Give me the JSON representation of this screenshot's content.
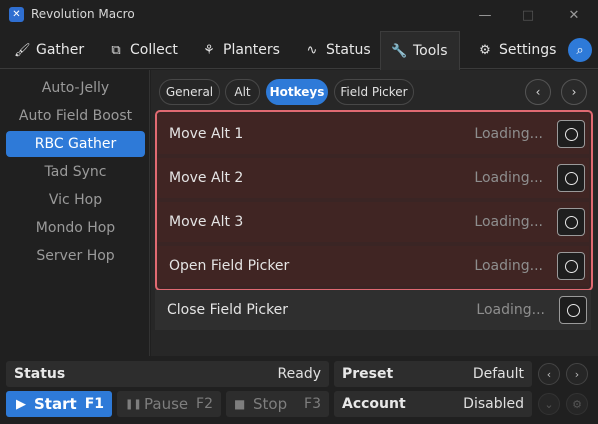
{
  "window": {
    "title": "Revolution Macro",
    "minimize": "—",
    "maximize": "□",
    "close": "✕"
  },
  "tabs": [
    {
      "label": "Gather",
      "icon": "brush-icon",
      "glyph": "🖌"
    },
    {
      "label": "Collect",
      "icon": "collect-icon",
      "glyph": "⧉"
    },
    {
      "label": "Planters",
      "icon": "planter-icon",
      "glyph": "⚘"
    },
    {
      "label": "Status",
      "icon": "pulse-icon",
      "glyph": "∿"
    },
    {
      "label": "Tools",
      "icon": "wrench-icon",
      "glyph": "🔧",
      "active": true
    },
    {
      "label": "Settings",
      "icon": "gear-icon",
      "glyph": "⚙"
    }
  ],
  "search_glyph": "⌕",
  "sidebar": {
    "items": [
      {
        "label": "Auto-Jelly"
      },
      {
        "label": "Auto Field Boost"
      },
      {
        "label": "RBC Gather",
        "active": true
      },
      {
        "label": "Tad Sync"
      },
      {
        "label": "Vic Hop"
      },
      {
        "label": "Mondo Hop"
      },
      {
        "label": "Server Hop"
      }
    ]
  },
  "subtabs": [
    {
      "label": "General"
    },
    {
      "label": "Alt"
    },
    {
      "label": "Hotkeys",
      "active": true
    },
    {
      "label": "Field Picker"
    }
  ],
  "nav": {
    "prev": "‹",
    "next": "›"
  },
  "hotkeys": [
    {
      "label": "Move Alt 1",
      "status": "Loading..."
    },
    {
      "label": "Move Alt 2",
      "status": "Loading..."
    },
    {
      "label": "Move Alt 3",
      "status": "Loading..."
    },
    {
      "label": "Open Field Picker",
      "status": "Loading..."
    },
    {
      "label": "Close Field Picker",
      "status": "Loading..."
    }
  ],
  "status_bar": {
    "status_label": "Status",
    "status_value": "Ready",
    "preset_label": "Preset",
    "preset_value": "Default",
    "account_label": "Account",
    "account_value": "Disabled"
  },
  "controls": {
    "start_label": "Start",
    "start_key": "F1",
    "start_glyph": "▶",
    "pause_label": "Pause",
    "pause_key": "F2",
    "pause_glyph": "❚❚",
    "stop_label": "Stop",
    "stop_key": "F3",
    "stop_glyph": "■"
  },
  "preset_nav": {
    "prev": "‹",
    "next": "›"
  },
  "account_icons": {
    "chevron": "⌄",
    "gear": "⚙"
  },
  "colors": {
    "accent": "#2e7ad8",
    "highlight_border": "#e06a72",
    "highlight_row": "#402523"
  }
}
